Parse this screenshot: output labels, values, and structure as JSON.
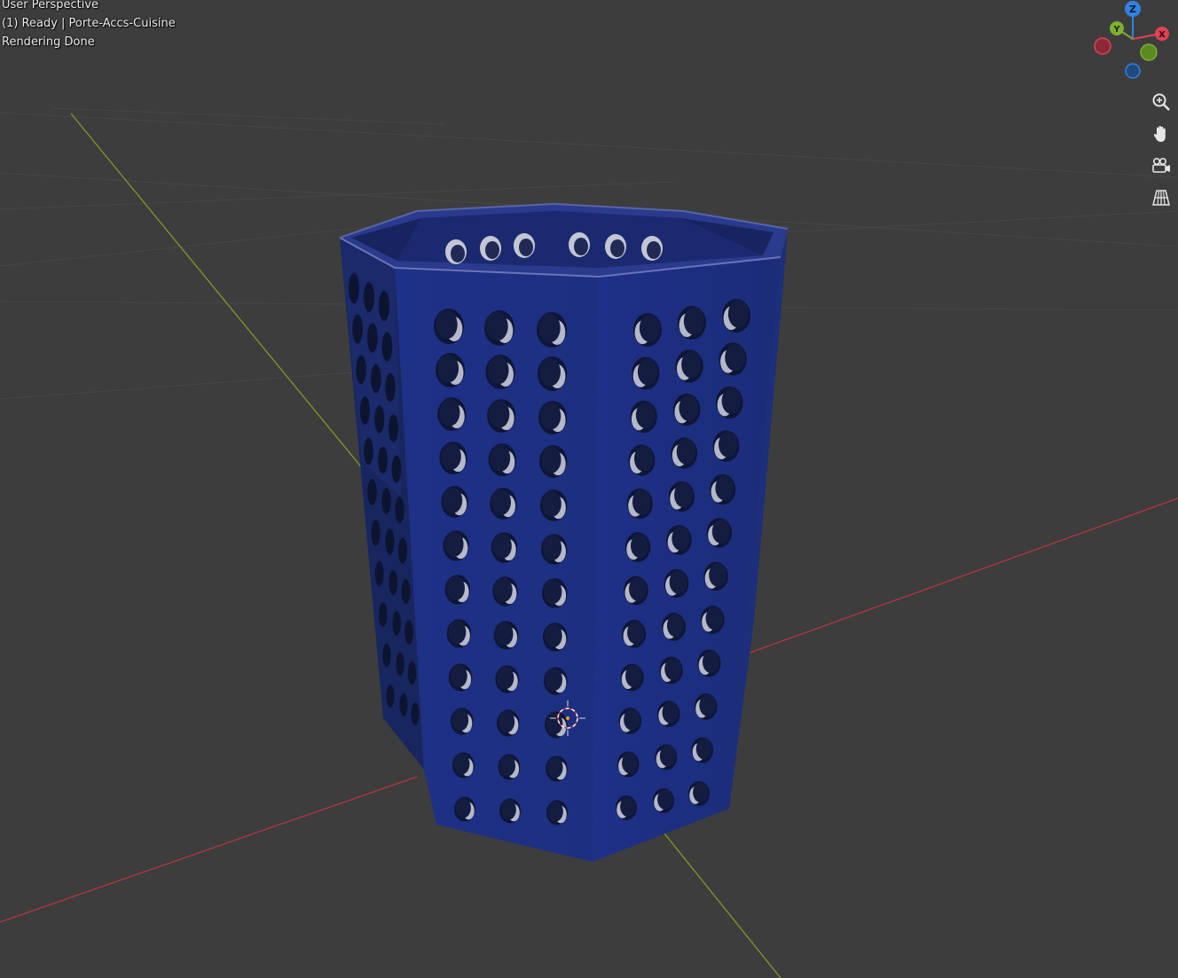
{
  "viewport": {
    "mode_label": "User Perspective",
    "object_label": "(1) Ready | Porte-Accs-Cuisine",
    "status_label": "Rendering Done"
  },
  "gizmo": {
    "z_label": "Z",
    "y_label": "Y",
    "x_label": "X",
    "colors": {
      "x": "#e04355",
      "y": "#7eb02e",
      "z": "#2f84e3"
    }
  },
  "nav_buttons": [
    {
      "name": "zoom-icon"
    },
    {
      "name": "pan-hand-icon"
    },
    {
      "name": "camera-view-icon"
    },
    {
      "name": "perspective-grid-icon"
    }
  ],
  "colors": {
    "background": "#3d3d3d",
    "object": "#1c2e7c",
    "x_axis": "#b53644",
    "y_axis": "#7f9b26"
  }
}
